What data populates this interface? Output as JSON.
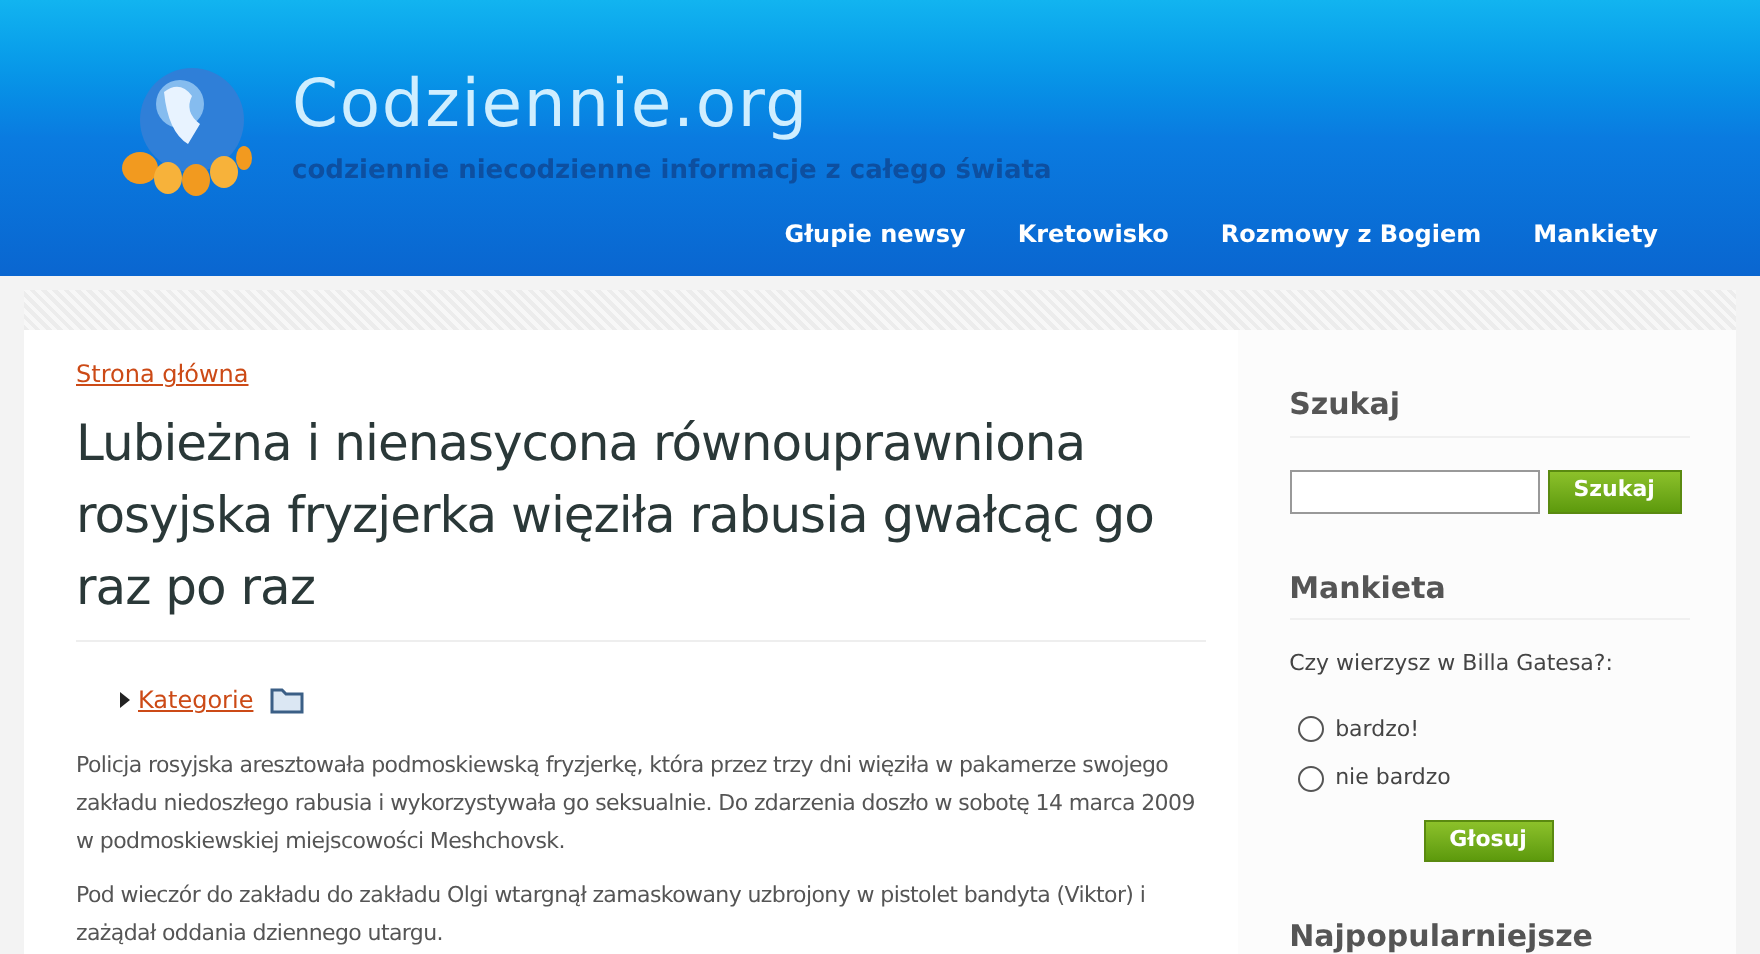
{
  "header": {
    "site_title": "Codziennie.org",
    "tagline": "codziennie niecodzienne informacje z całego świata",
    "nav": [
      "Głupie newsy",
      "Kretowisko",
      "Rozmowy z Bogiem",
      "Mankiety"
    ]
  },
  "article": {
    "breadcrumb": "Strona główna",
    "title": "Lubieżna i nienasycona równouprawniona rosyjska fryzjerka więziła rabusia gwałcąc go raz po raz",
    "category_link": "Kategorie",
    "paragraphs": [
      "Policja rosyjska aresztowała podmoskiewską fryzjerkę, która przez trzy dni więziła w pakamerze swojego zakładu niedoszłego rabusia i wykorzystywała go seksualnie. Do zdarzenia doszło w sobotę 14 marca 2009 w podmoskiewskiej miejscowości Meshchovsk.",
      "Pod wieczór do zakładu do zakładu Olgi wtargnął zamaskowany uzbrojony w pistolet bandyta (Viktor) i zażądał oddania dziennego utargu."
    ]
  },
  "sidebar": {
    "search_heading": "Szukaj",
    "search_button": "Szukaj",
    "poll_heading": "Mankieta",
    "poll_question": "Czy wierzysz w Billa Gatesa?:",
    "options": [
      {
        "label": "bardzo!",
        "selected": false
      },
      {
        "label": "nie bardzo",
        "selected": false
      }
    ],
    "vote_button": "Głosuj",
    "popular_heading": "Najpopularniejsze"
  }
}
